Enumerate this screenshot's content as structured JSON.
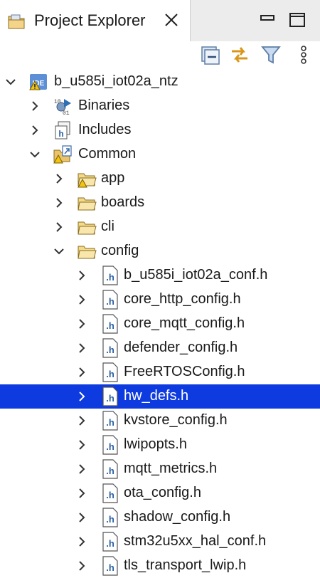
{
  "panel": {
    "title": "Project Explorer",
    "selection_color": "#0d3be0"
  },
  "toolbar": {
    "icons": [
      "collapse-all-icon",
      "link-with-editor-icon",
      "filter-icon",
      "view-menu-icon"
    ]
  },
  "tree": {
    "project": "b_u585i_iot02a_ntz",
    "binaries": "Binaries",
    "includes": "Includes",
    "common": "Common",
    "folders": {
      "app": "app",
      "boards": "boards",
      "cli": "cli",
      "config": "config"
    },
    "config_files": [
      "b_u585i_iot02a_conf.h",
      "core_http_config.h",
      "core_mqtt_config.h",
      "defender_config.h",
      "FreeRTOSConfig.h",
      "hw_defs.h",
      "kvstore_config.h",
      "lwipopts.h",
      "mqtt_metrics.h",
      "ota_config.h",
      "shadow_config.h",
      "stm32u5xx_hal_conf.h",
      "tls_transport_lwip.h"
    ],
    "selected_file": "hw_defs.h"
  }
}
